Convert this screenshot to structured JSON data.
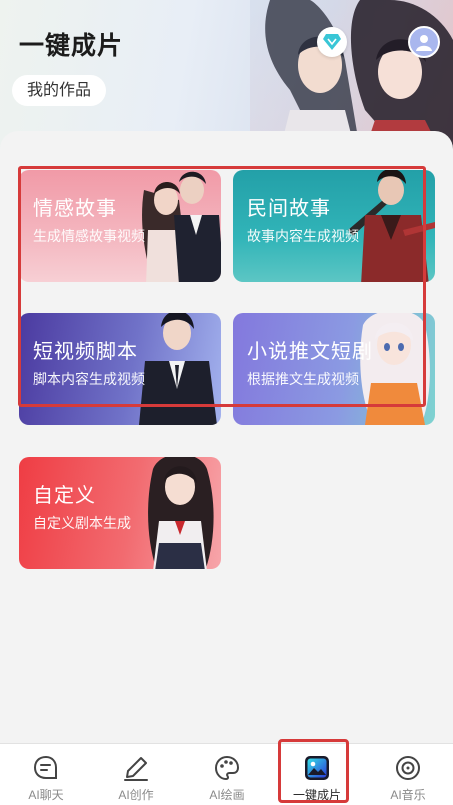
{
  "header": {
    "title": "一键成片",
    "works_button": "我的作品",
    "hero_logo_text": "V"
  },
  "cards": [
    {
      "title": "情感故事",
      "subtitle": "生成情感故事视频"
    },
    {
      "title": "民间故事",
      "subtitle": "故事内容生成视频"
    },
    {
      "title": "短视频脚本",
      "subtitle": "脚本内容生成视频"
    },
    {
      "title": "小说推文短剧",
      "subtitle": "根据推文生成视频"
    },
    {
      "title": "自定义",
      "subtitle": "自定义剧本生成"
    }
  ],
  "tabbar": {
    "items": [
      {
        "label": "AI聊天",
        "icon": "chat-icon"
      },
      {
        "label": "AI创作",
        "icon": "pen-icon"
      },
      {
        "label": "AI绘画",
        "icon": "palette-icon"
      },
      {
        "label": "一键成片",
        "icon": "image-icon",
        "active": true
      },
      {
        "label": "AI音乐",
        "icon": "disc-icon"
      }
    ]
  },
  "colors": {
    "highlight": "#d63a3a",
    "accent_active": "#1e2bd8",
    "vip": "#39c6d6"
  }
}
